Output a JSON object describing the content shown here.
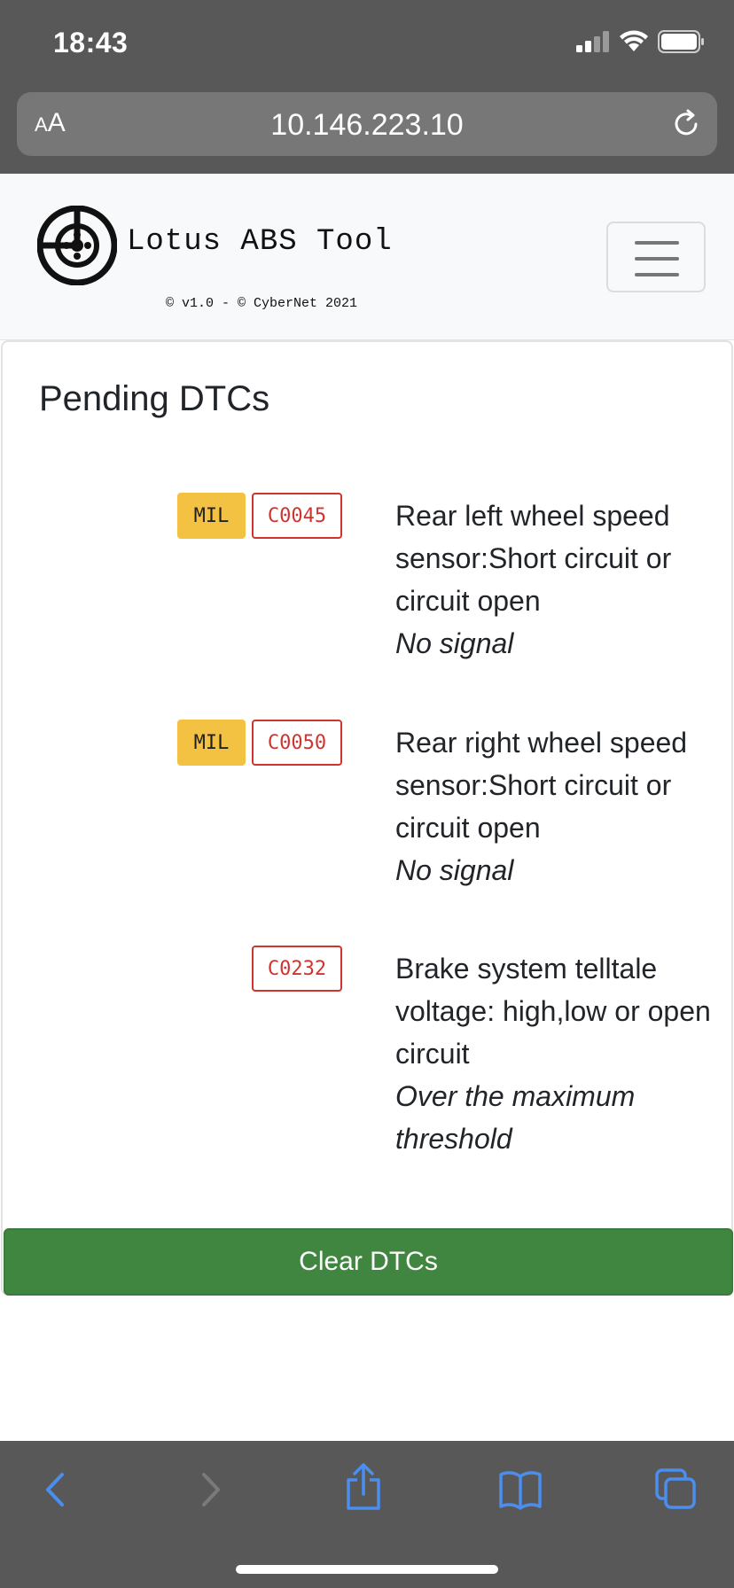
{
  "status_bar": {
    "time": "18:43"
  },
  "browser": {
    "text_size_button": {
      "small": "A",
      "large": "A"
    },
    "url": "10.146.223.10"
  },
  "navbar": {
    "brand": "Lotus ABS Tool",
    "subtitle": "© v1.0 - © CyberNet 2021"
  },
  "card": {
    "title": "Pending DTCs",
    "dtcs": [
      {
        "mil": "MIL",
        "code": "C0045",
        "description": "Rear left wheel speed sensor:Short circuit or circuit open",
        "detail": "No signal"
      },
      {
        "mil": "MIL",
        "code": "C0050",
        "description": "Rear right wheel speed sensor:Short circuit or circuit open",
        "detail": "No signal"
      },
      {
        "mil": null,
        "code": "C0232",
        "description": "Brake system telltale voltage: high,low or open circuit",
        "detail": "Over the maximum threshold"
      }
    ],
    "clear_button": "Clear DTCs"
  },
  "toolbar": {
    "icons": [
      "back-icon",
      "forward-icon",
      "share-icon",
      "bookmarks-icon",
      "tabs-icon"
    ]
  },
  "colors": {
    "mil_badge": "#f4c242",
    "code_badge": "#d0342f",
    "clear_button": "#408540",
    "toolbar_icon": "#4a8ef0",
    "browser_chrome": "#585858"
  }
}
